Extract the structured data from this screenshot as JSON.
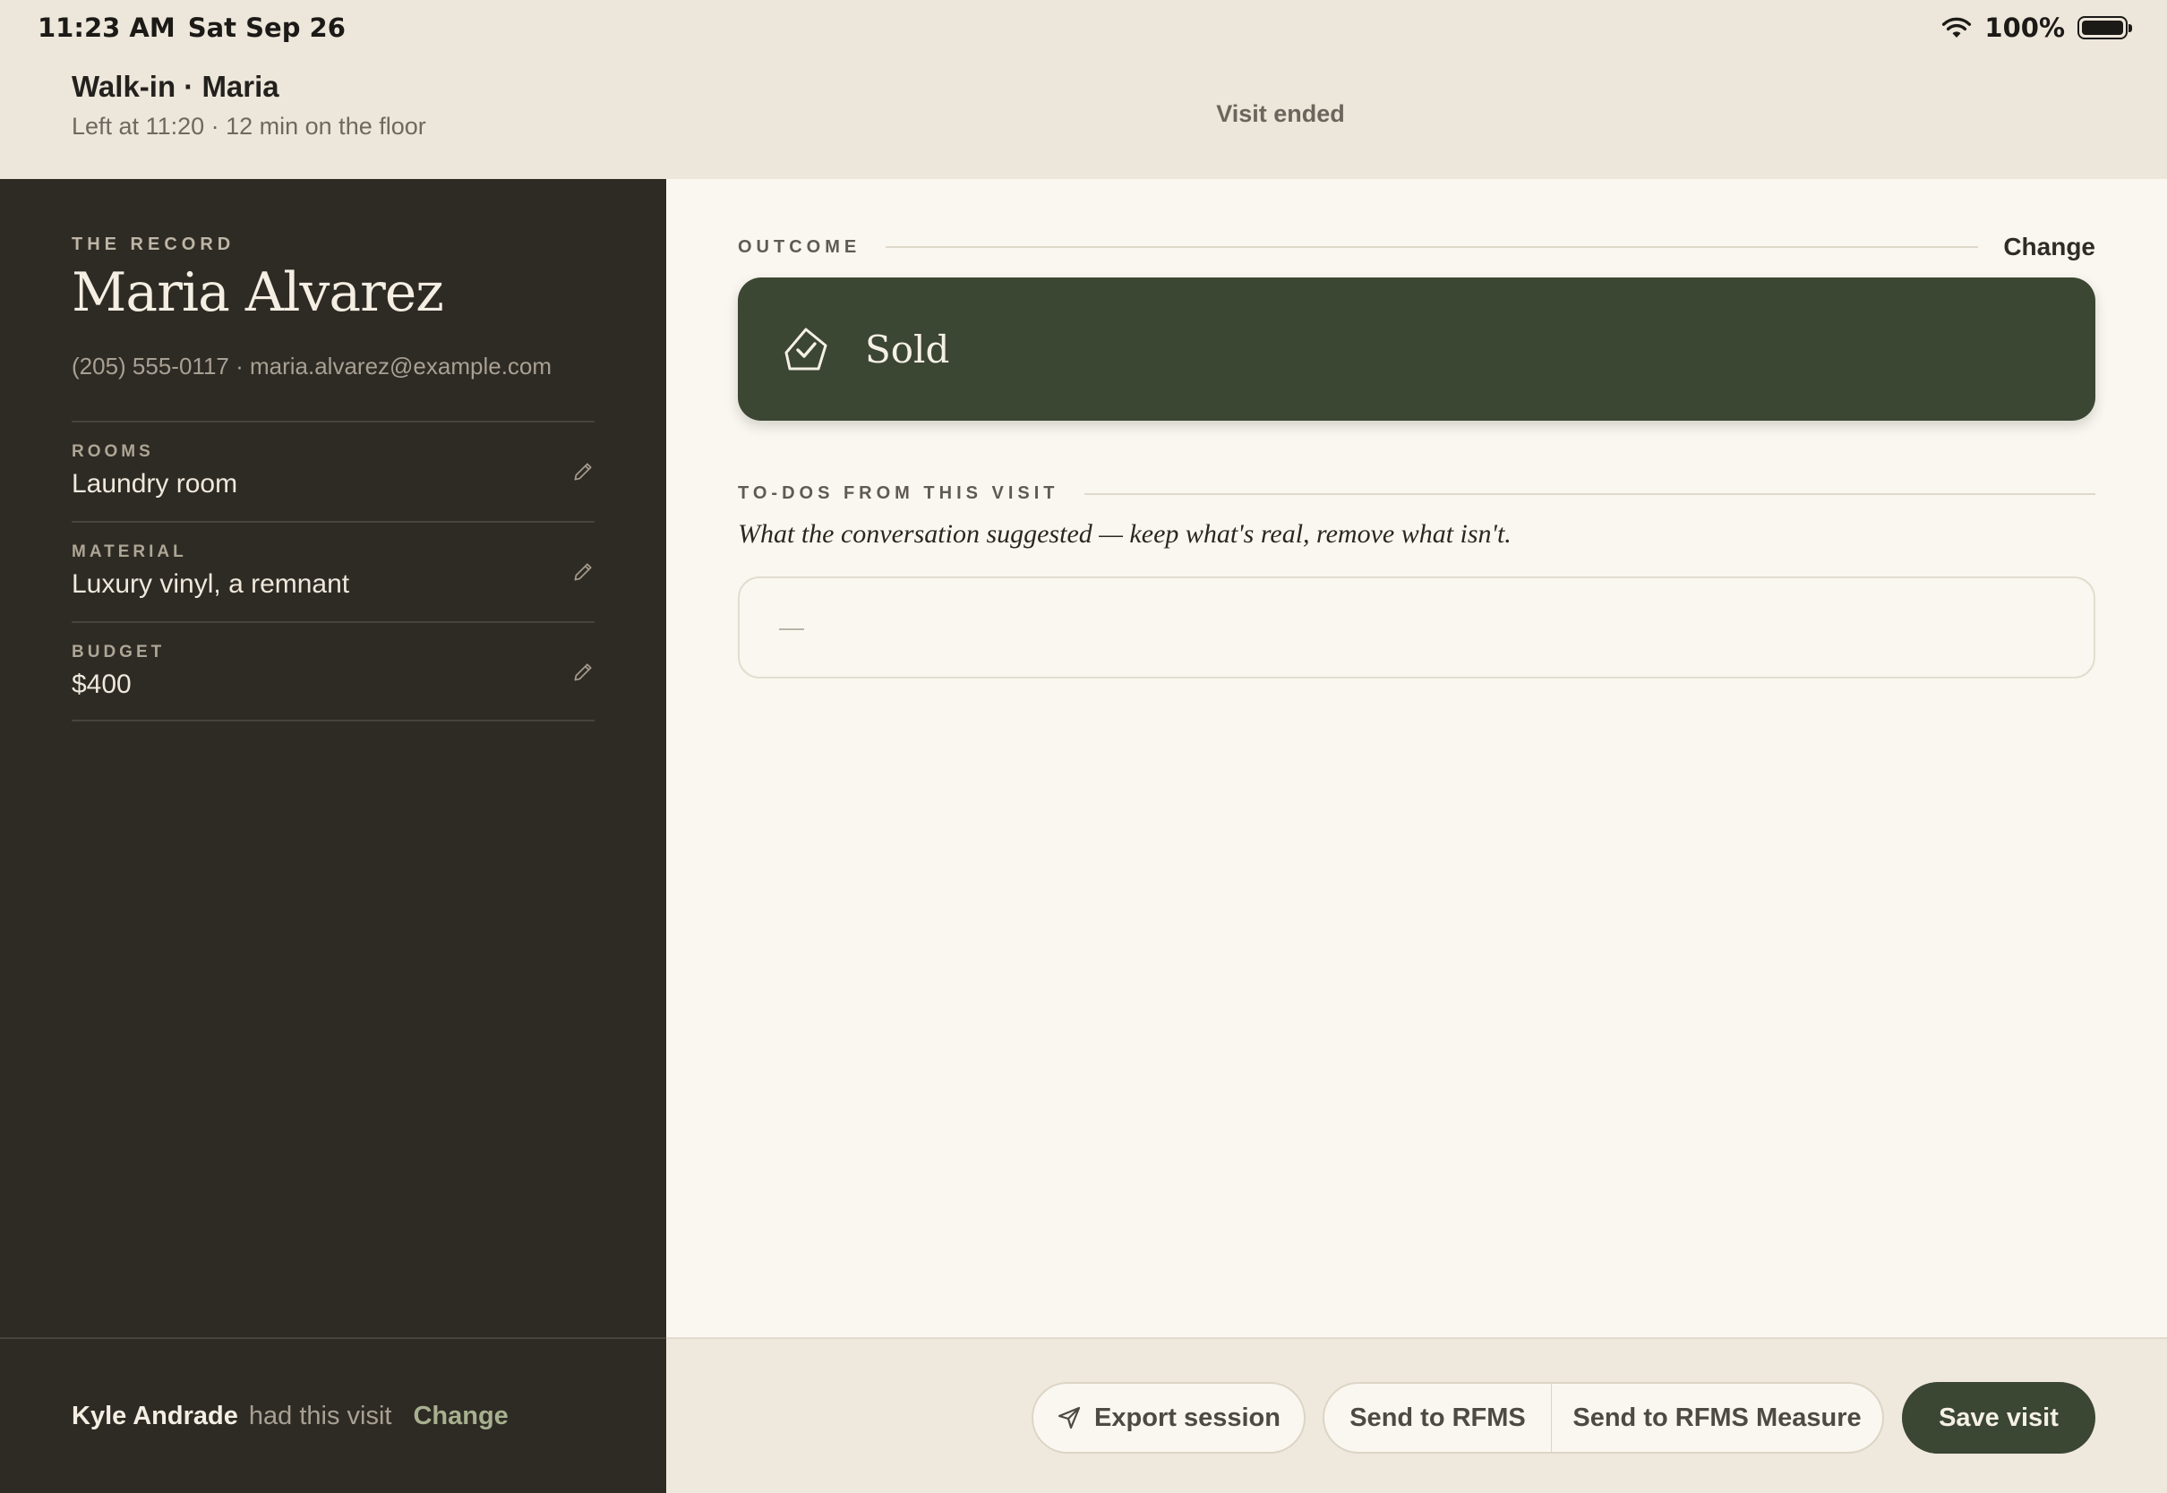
{
  "status_bar": {
    "time": "11:23 AM",
    "date": "Sat Sep 26",
    "battery": "100%"
  },
  "header": {
    "title": "Walk-in · Maria",
    "subtitle": "Left at 11:20 · 12 min on the floor",
    "status": "Visit ended"
  },
  "record": {
    "kicker": "THE RECORD",
    "name": "Maria Alvarez",
    "contact": "(205) 555-0117 · maria.alvarez@example.com",
    "fields": [
      {
        "label": "ROOMS",
        "value": "Laundry room"
      },
      {
        "label": "MATERIAL",
        "value": "Luxury vinyl, a remnant"
      },
      {
        "label": "BUDGET",
        "value": "$400"
      }
    ]
  },
  "attribution": {
    "who": "Kyle Andrade",
    "had": "had this visit",
    "change": "Change"
  },
  "outcome": {
    "label": "OUTCOME",
    "change": "Change",
    "value": "Sold"
  },
  "todos": {
    "label": "TO-DOS FROM THIS VISIT",
    "subtitle": "What the conversation suggested — keep what's real, remove what isn't.",
    "empty": "—"
  },
  "toolbar": {
    "export": "Export session",
    "send_rfms": "Send to RFMS",
    "send_measure": "Send to RFMS Measure",
    "save": "Save visit"
  },
  "colors": {
    "accent": "#3b4633",
    "sidebar": "#2e2a24",
    "background": "#faf7f0"
  }
}
